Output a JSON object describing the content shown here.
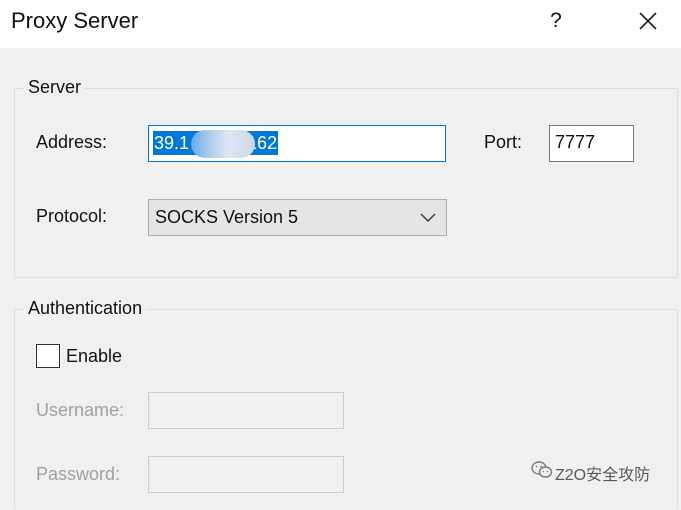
{
  "window": {
    "title": "Proxy Server",
    "help_label": "?"
  },
  "server_group": {
    "label": "Server",
    "address_label": "Address:",
    "address_value_start": "39.1",
    "address_value_end": "162",
    "port_label": "Port:",
    "port_value": "7777",
    "protocol_label": "Protocol:",
    "protocol_selected": "SOCKS Version 5"
  },
  "auth_group": {
    "label": "Authentication",
    "enable_label": "Enable",
    "enable_checked": false,
    "username_label": "Username:",
    "username_value": "",
    "password_label": "Password:",
    "password_value": ""
  },
  "watermark": {
    "text": "Z2O安全攻防",
    "icon": "wechat-icon"
  },
  "colors": {
    "accent": "#0078d7",
    "background": "#f0f0f0",
    "disabled_text": "#a0a0a0"
  }
}
